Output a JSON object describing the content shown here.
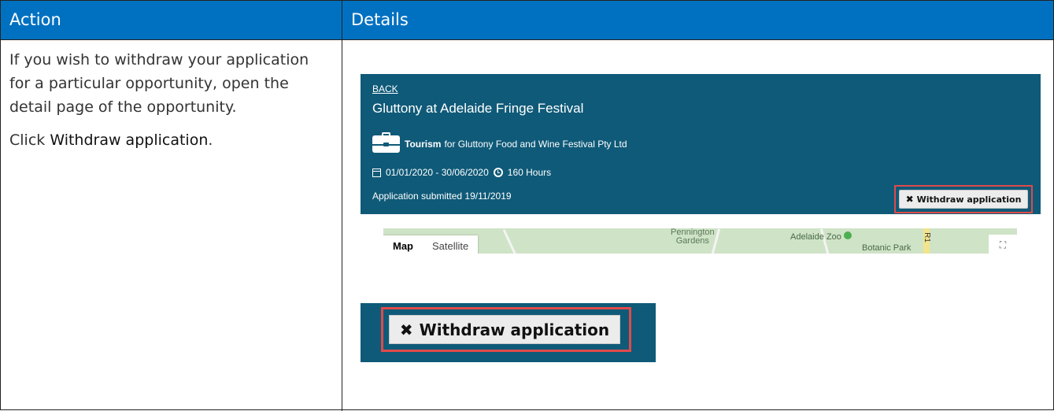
{
  "header": {
    "action": "Action",
    "details": "Details"
  },
  "action": {
    "paragraph1": "If you wish to withdraw your application for a particular opportunity, open the detail page of the opportunity.",
    "paragraph2_prefix": "Click ",
    "paragraph2_emphasis": "Withdraw application",
    "paragraph2_suffix": "."
  },
  "banner": {
    "back": "BACK",
    "title": "Gluttony at Adelaide Fringe Festival",
    "sector": "Tourism",
    "organisation": "for Gluttony Food and Wine Festival Pty Ltd",
    "dates": "01/01/2020 - 30/06/2020",
    "hours": "160 Hours",
    "submitted": "Application submitted 19/11/2019",
    "withdraw_label": "Withdraw application",
    "background_color": "#0f5a78",
    "highlight_color": "#e04a4a"
  },
  "map": {
    "tab_map": "Map",
    "tab_satellite": "Satellite",
    "label_gardens": "Pennington\nGardens",
    "label_zoo": "Adelaide Zoo",
    "label_park": "Botanic Park",
    "label_road": "R1"
  },
  "zoom": {
    "withdraw_label": "Withdraw application"
  },
  "colors": {
    "header_bg": "#0071c1",
    "header_text": "#ffffff"
  }
}
